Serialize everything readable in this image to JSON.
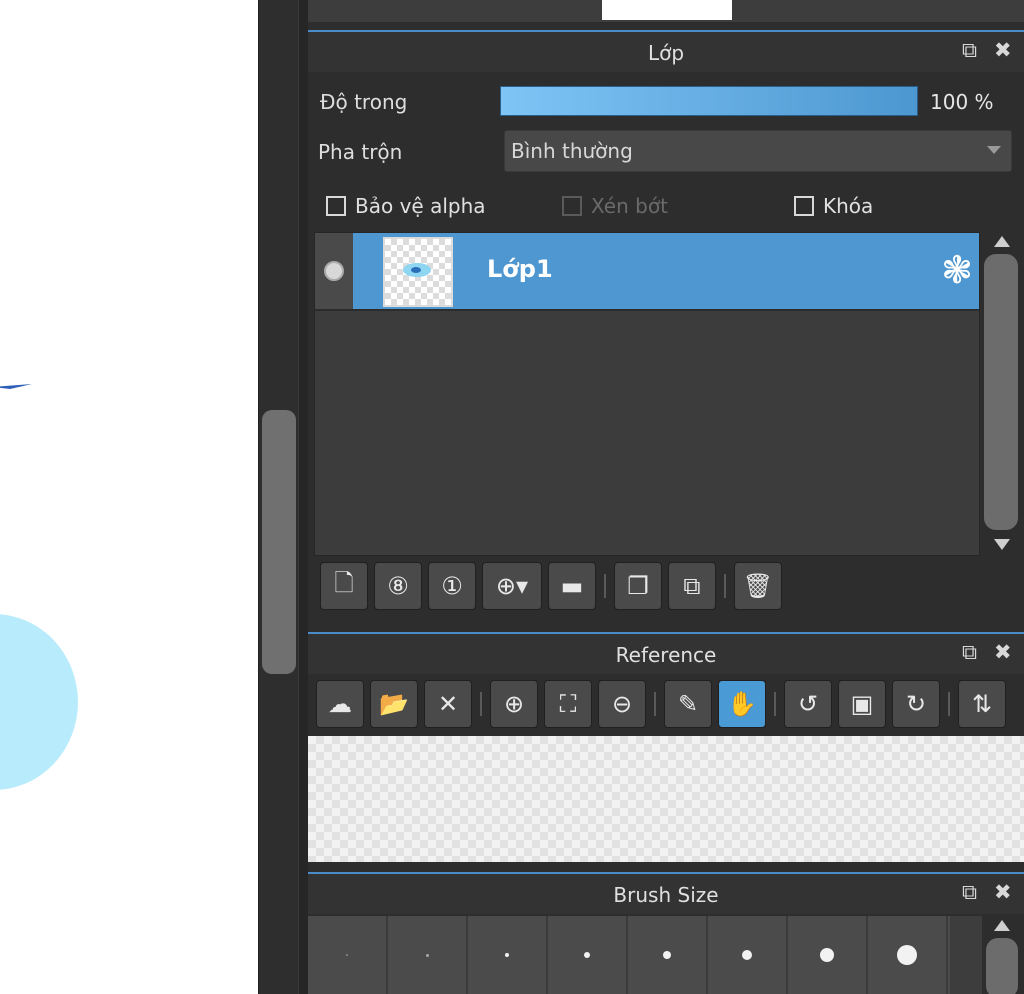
{
  "layer_panel": {
    "title": "Lớp",
    "opacity_label": "Độ trong",
    "opacity_value": "100 %",
    "opacity_fraction": 1.0,
    "blend_label": "Pha trộn",
    "blend_value": "Bình thường",
    "checkboxes": [
      {
        "label": "Bảo vệ alpha",
        "checked": false,
        "enabled": true
      },
      {
        "label": "Xén bớt",
        "checked": false,
        "enabled": false
      },
      {
        "label": "Khóa",
        "checked": false,
        "enabled": true
      }
    ],
    "layers": [
      {
        "name": "Lớp1",
        "visible": true,
        "selected": true
      }
    ],
    "toolbar_icons": [
      "new-layer-icon",
      "new-8bit-layer-icon",
      "new-1bit-layer-icon",
      "add-layer-dropdown-icon",
      "new-folder-icon",
      "duplicate-layer-icon",
      "merge-layer-icon",
      "delete-layer-icon"
    ]
  },
  "reference_panel": {
    "title": "Reference",
    "toolbar_icons": [
      "cloud-download-icon",
      "open-folder-icon",
      "close-icon",
      "zoom-in-icon",
      "fit-icon",
      "zoom-out-icon",
      "eyedropper-icon",
      "hand-icon",
      "rotate-left-icon",
      "actual-size-icon",
      "rotate-right-icon",
      "flip-icon"
    ],
    "active_tool": "hand-icon"
  },
  "brush_size_panel": {
    "title": "Brush Size"
  },
  "colors": {
    "accent": "#4f97d0",
    "panel_bg": "#2d2d2d",
    "header_bg": "#333333",
    "blob": "#b8ecfc"
  }
}
